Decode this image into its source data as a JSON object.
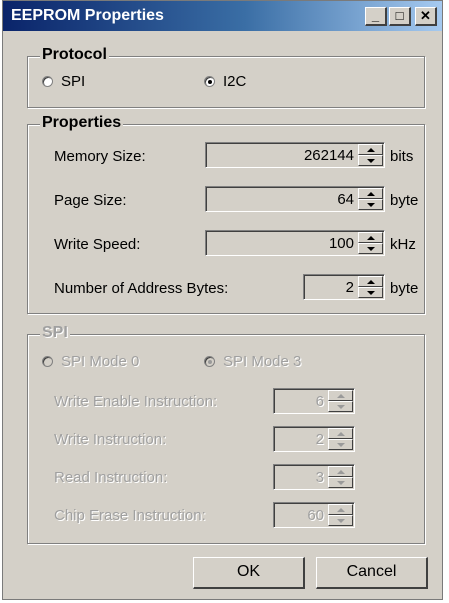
{
  "window": {
    "title": "EEPROM Properties",
    "minimize_label": "_",
    "maximize_label": "□",
    "close_label": "✕"
  },
  "protocol": {
    "legend": "Protocol",
    "options": [
      {
        "label": "SPI",
        "selected": false
      },
      {
        "label": "I2C",
        "selected": true
      }
    ]
  },
  "properties": {
    "legend": "Properties",
    "rows": [
      {
        "label": "Memory Size:",
        "value": "262144",
        "unit": "bits"
      },
      {
        "label": "Page Size:",
        "value": "64",
        "unit": "byte"
      },
      {
        "label": "Write Speed:",
        "value": "100",
        "unit": "kHz"
      },
      {
        "label": "Number of Address Bytes:",
        "value": "2",
        "unit": "byte"
      }
    ]
  },
  "spi": {
    "legend": "SPI",
    "enabled": false,
    "modes": [
      {
        "label": "SPI Mode 0",
        "selected": false
      },
      {
        "label": "SPI Mode 3",
        "selected": true
      }
    ],
    "rows": [
      {
        "label": "Write Enable Instruction:",
        "value": "6"
      },
      {
        "label": "Write Instruction:",
        "value": "2"
      },
      {
        "label": "Read Instruction:",
        "value": "3"
      },
      {
        "label": "Chip Erase Instruction:",
        "value": "60"
      }
    ]
  },
  "buttons": {
    "ok": "OK",
    "cancel": "Cancel"
  }
}
